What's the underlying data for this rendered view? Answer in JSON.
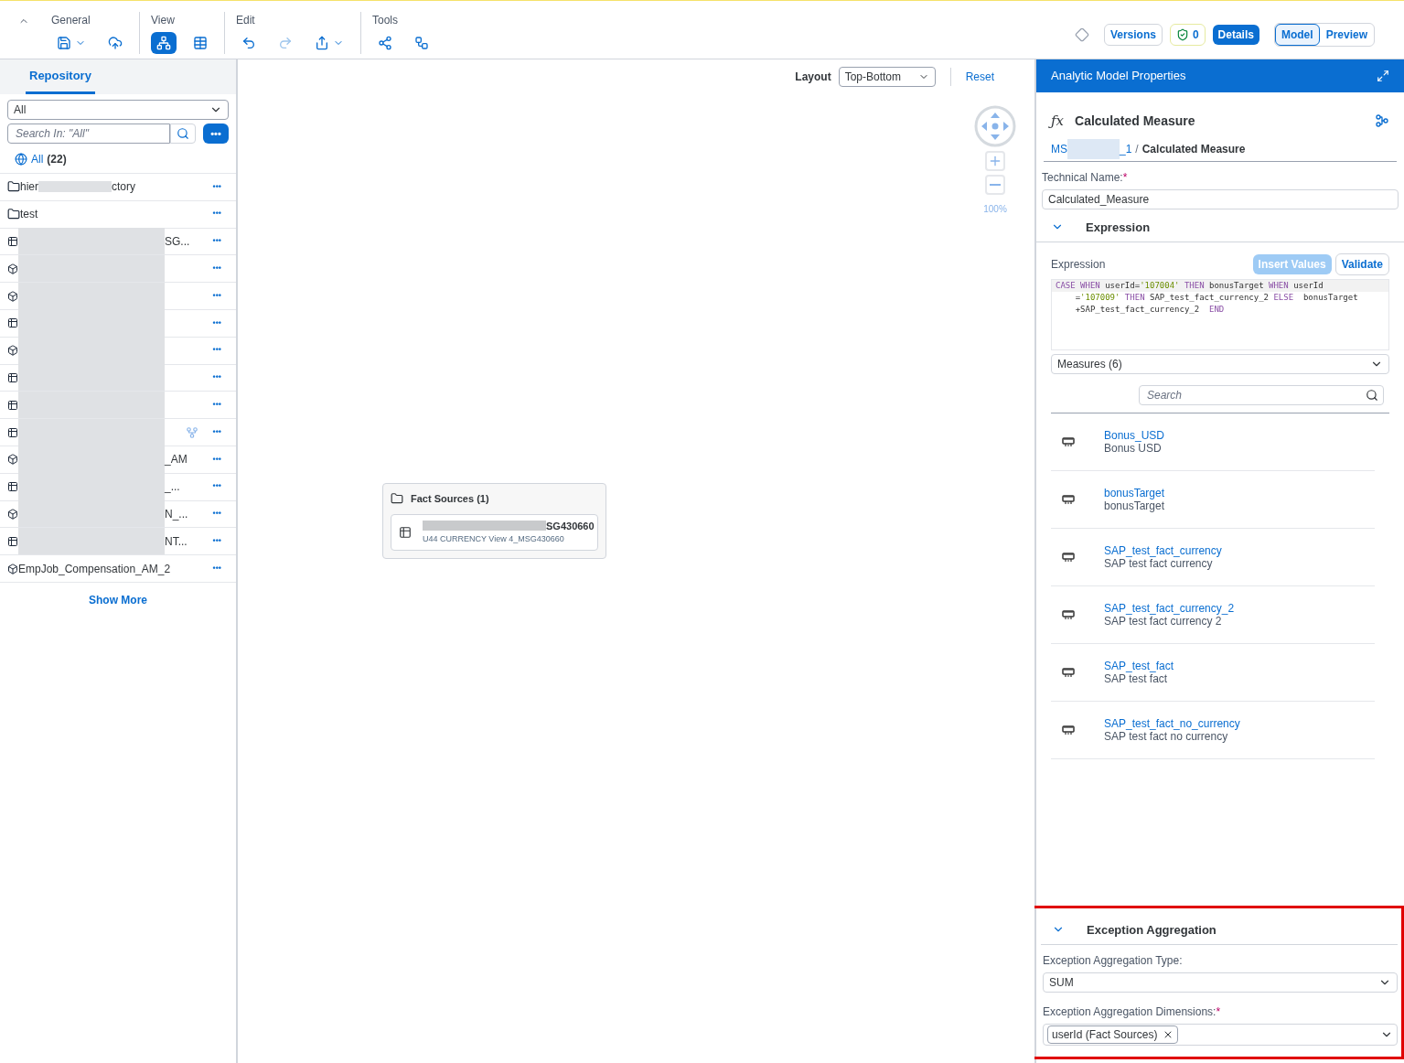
{
  "toolbar": {
    "groups": [
      {
        "label": "General",
        "tools": [
          {
            "menu": true,
            "selected": false,
            "disabled": false
          },
          {
            "menu": false,
            "selected": false,
            "disabled": false
          }
        ]
      },
      {
        "label": "View",
        "tools": [
          {
            "menu": false,
            "selected": true,
            "disabled": false
          },
          {
            "menu": false,
            "selected": false,
            "disabled": false
          }
        ]
      },
      {
        "label": "Edit",
        "tools": [
          {
            "menu": false,
            "selected": false,
            "disabled": false
          },
          {
            "menu": false,
            "selected": false,
            "disabled": true
          },
          {
            "menu": true,
            "selected": false,
            "disabled": false
          }
        ]
      },
      {
        "label": "Tools",
        "tools": [
          {
            "menu": false,
            "selected": false,
            "disabled": false
          },
          {
            "menu": false,
            "selected": false,
            "disabled": false
          }
        ]
      }
    ],
    "right": {
      "versions": "Versions",
      "validation_count": "0",
      "details": "Details",
      "modes": [
        {
          "label": "Model",
          "selected": true
        },
        {
          "label": "Preview",
          "selected": false
        }
      ]
    }
  },
  "repository": {
    "tab": "Repository",
    "filter": "All",
    "search_placeholder": "Search In: \"All\"",
    "more_label": "•••",
    "all_label": "All",
    "count": "(22)",
    "rows": [
      {
        "kind": "folder",
        "start": "hier",
        "end": "ctory",
        "redacted": true,
        "menu": "•••"
      },
      {
        "kind": "folder",
        "start": "test",
        "redacted": false,
        "menu": "•••"
      },
      {
        "kind": "table",
        "end": "SG...",
        "redacted": true,
        "menu": "•••"
      },
      {
        "kind": "cube",
        "redacted": true,
        "menu": "•••"
      },
      {
        "kind": "cube",
        "redacted": true,
        "menu": "•••"
      },
      {
        "kind": "table",
        "redacted": true,
        "menu": "•••"
      },
      {
        "kind": "cube",
        "redacted": true,
        "menu": "•••"
      },
      {
        "kind": "table",
        "redacted": true,
        "menu": "•••"
      },
      {
        "kind": "table",
        "redacted": true,
        "menu": "•••"
      },
      {
        "kind": "table",
        "redacted": true,
        "shared": true,
        "menu": "•••"
      },
      {
        "kind": "cube",
        "end": "_AM",
        "redacted": true,
        "menu": "•••"
      },
      {
        "kind": "table",
        "end": "_...",
        "redacted": true,
        "menu": "•••"
      },
      {
        "kind": "cube",
        "end": "N_...",
        "redacted": true,
        "menu": "•••"
      },
      {
        "kind": "table",
        "end": "NT...",
        "redacted": true,
        "menu": "•••"
      },
      {
        "kind": "cube",
        "start": "EmpJob_Compensation_AM_2",
        "redacted": false,
        "menu": "•••"
      }
    ],
    "show_more": "Show More"
  },
  "canvas": {
    "layout_label": "Layout",
    "layout_value": "Top-Bottom",
    "reset": "Reset",
    "zoom": "100%",
    "node": {
      "title": "Fact Sources (1)",
      "item_name": "SG430660",
      "item_sub": "U44 CURRENCY View 4_MSG430660"
    }
  },
  "properties": {
    "title": "Analytic Model Properties",
    "function_symbol": "ƒx",
    "heading": "Calculated Measure",
    "breadcrumb_start": "MS",
    "breadcrumb_end": "_1",
    "breadcrumb_separator": "/",
    "breadcrumb_current": "Calculated Measure",
    "technical_name_label": "Technical Name:",
    "technical_name_required": "*",
    "technical_name": "Calculated_Measure",
    "expression_section": {
      "title": "Expression",
      "expanded": true,
      "label": "Expression",
      "insert_values": "Insert Values",
      "validate": "Validate",
      "code": [
        [
          {
            "kind": "keyword",
            "text": "CASE "
          },
          {
            "kind": "keyword",
            "text": "WHEN "
          },
          {
            "kind": "plain",
            "text": "userId="
          },
          {
            "kind": "string",
            "text": "'107004'"
          },
          {
            "kind": "keyword",
            "text": " THEN "
          },
          {
            "kind": "plain",
            "text": "bonusTarget "
          },
          {
            "kind": "keyword",
            "text": "WHEN "
          },
          {
            "kind": "plain",
            "text": "userId"
          }
        ],
        [
          {
            "kind": "plain",
            "text": "    ="
          },
          {
            "kind": "string",
            "text": "'107009'"
          },
          {
            "kind": "keyword",
            "text": " THEN "
          },
          {
            "kind": "plain",
            "text": "SAP_test_fact_currency_2 "
          },
          {
            "kind": "keyword",
            "text": "ELSE "
          },
          {
            "kind": "plain",
            "text": " bonusTarget"
          }
        ],
        [
          {
            "kind": "plain",
            "text": "    +SAP_test_fact_currency_2  "
          },
          {
            "kind": "keyword",
            "text": "END"
          }
        ]
      ],
      "measures_select": "Measures (6)",
      "search_placeholder": "Search",
      "measures": [
        {
          "name": "Bonus_USD",
          "label": "Bonus USD"
        },
        {
          "name": "bonusTarget",
          "label": "bonusTarget"
        },
        {
          "name": "SAP_test_fact_currency",
          "label": "SAP test fact currency"
        },
        {
          "name": "SAP_test_fact_currency_2",
          "label": "SAP test fact currency 2"
        },
        {
          "name": "SAP_test_fact",
          "label": "SAP test fact"
        },
        {
          "name": "SAP_test_fact_no_currency",
          "label": "SAP test fact no currency"
        }
      ]
    },
    "exception_section": {
      "title": "Exception Aggregation",
      "expanded": true,
      "highlighted": true,
      "type_label": "Exception Aggregation Type:",
      "type_value": "SUM",
      "dimensions_label": "Exception Aggregation Dimensions:",
      "dimensions_required": "*",
      "dimension_tokens": [
        "userId (Fact Sources)"
      ]
    }
  }
}
